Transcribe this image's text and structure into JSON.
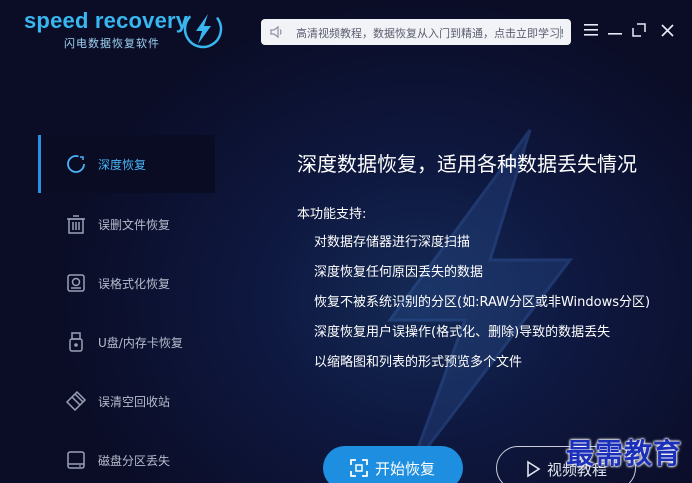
{
  "header": {
    "logo_text": "speed recovery",
    "logo_subtitle": "闪电数据恢复软件",
    "notice_text": "高清视频教程，数据恢复从入门到精通，点击立即学习!"
  },
  "sidebar": {
    "items": [
      {
        "label": "深度恢复",
        "icon": "deep-recovery-icon",
        "active": true
      },
      {
        "label": "误删文件恢复",
        "icon": "trash-icon",
        "active": false
      },
      {
        "label": "误格式化恢复",
        "icon": "format-disk-icon",
        "active": false
      },
      {
        "label": "U盘/内存卡恢复",
        "icon": "usb-drive-icon",
        "active": false
      },
      {
        "label": "误清空回收站",
        "icon": "eraser-icon",
        "active": false
      },
      {
        "label": "磁盘分区丢失",
        "icon": "hard-disk-icon",
        "active": false
      }
    ]
  },
  "main": {
    "title": "深度数据恢复，适用各种数据丢失情况",
    "support_heading": "本功能支持:",
    "features": [
      "对数据存储器进行深度扫描",
      "深度恢复任何原因丢失的数据",
      "恢复不被系统识别的分区(如:RAW分区或非Windows分区)",
      "深度恢复用户误操作(格式化、删除)导致的数据丢失",
      "以缩略图和列表的形式预览多个文件"
    ],
    "start_button": "开始恢复",
    "video_button": "视频教程"
  },
  "watermark": "最需教育",
  "colors": {
    "accent": "#1e8fe0",
    "logo": "#37b6ef",
    "background": "#0b0d27"
  }
}
